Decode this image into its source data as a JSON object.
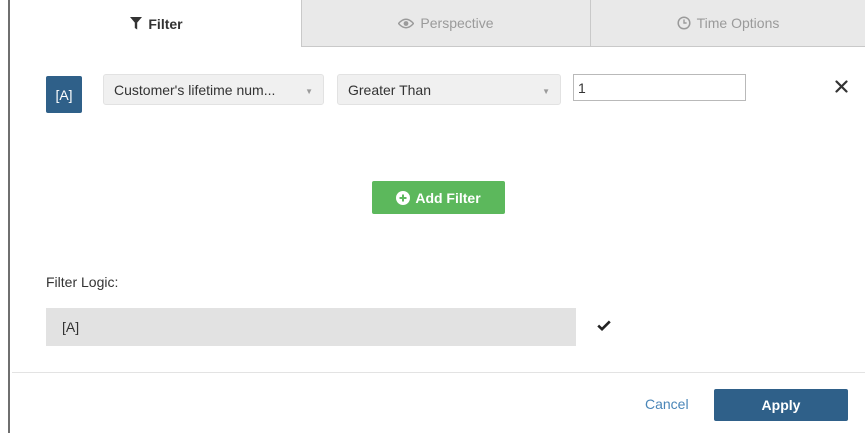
{
  "tabs": [
    {
      "label": "Filter",
      "icon": "funnel-icon",
      "active": true
    },
    {
      "label": "Perspective",
      "icon": "eye-icon",
      "active": false
    },
    {
      "label": "Time Options",
      "icon": "clock-icon",
      "active": false
    }
  ],
  "filter_row": {
    "badge": "[A]",
    "field_select": "Customer's lifetime num...",
    "operator_select": "Greater Than",
    "value": "1",
    "remove_icon": "close-icon"
  },
  "add_filter": {
    "label": "Add Filter",
    "icon": "plus-circle-icon"
  },
  "filter_logic": {
    "label": "Filter Logic:",
    "value": "[A]",
    "valid_icon": "checkmark-icon"
  },
  "footer": {
    "cancel_label": "Cancel",
    "apply_label": "Apply"
  },
  "colors": {
    "primary": "#2f6089",
    "success": "#5cb85c",
    "link": "#4a86b8",
    "tab_inactive_bg": "#e9e9e9"
  }
}
